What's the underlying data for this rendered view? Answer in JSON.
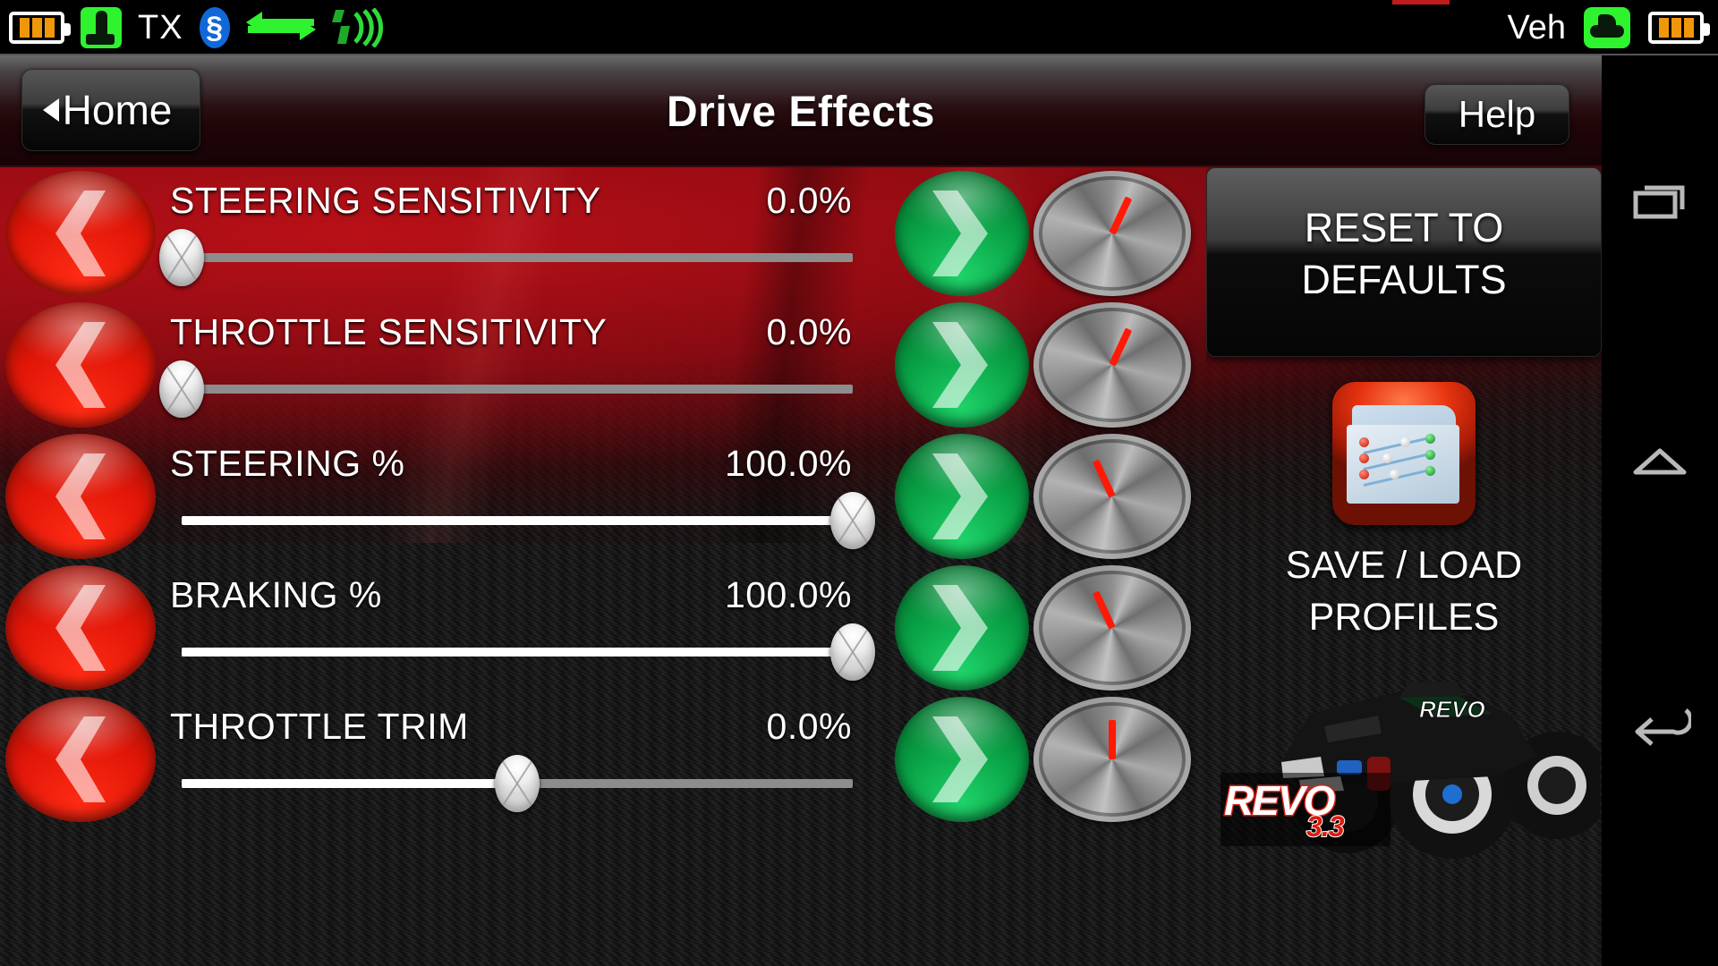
{
  "statusbar": {
    "battery_left_icon": "battery-icon",
    "tx_icon": "transmitter-icon",
    "tx_label": "TX",
    "bluetooth_icon": "bluetooth-icon",
    "link_icon": "two-way-link-icon",
    "signal_icon": "signal-strength-icon",
    "vehicle_label": "Veh",
    "vehicle_icon": "vehicle-icon",
    "battery_right_icon": "battery-icon",
    "accent_orange": "#f0960a",
    "accent_green": "#2ff32f",
    "accent_blue": "#1168d8",
    "accent_red": "#c21b1b"
  },
  "titlebar": {
    "home_label": "Home",
    "title": "Drive Effects",
    "help_label": "Help"
  },
  "rows": [
    {
      "label": "STEERING SENSITIVITY",
      "value": "0.0%",
      "fill_pct": 0,
      "thumb_pct": 0,
      "dial_deg": 205,
      "highlight": true
    },
    {
      "label": "THROTTLE SENSITIVITY",
      "value": "0.0%",
      "fill_pct": 0,
      "thumb_pct": 0,
      "dial_deg": 205,
      "highlight": true
    },
    {
      "label": "STEERING %",
      "value": "100.0%",
      "fill_pct": 100,
      "thumb_pct": 100,
      "dial_deg": 155,
      "highlight": false
    },
    {
      "label": "BRAKING %",
      "value": "100.0%",
      "fill_pct": 100,
      "thumb_pct": 100,
      "dial_deg": 155,
      "highlight": false
    },
    {
      "label": "THROTTLE TRIM",
      "value": "0.0%",
      "fill_pct": 50,
      "thumb_pct": 50,
      "dial_deg": 180,
      "highlight": false
    }
  ],
  "row_controls": {
    "decrement_icon": "chevron-left-icon",
    "increment_icon": "chevron-right-icon",
    "dial_icon": "rotary-dial-icon"
  },
  "rightpanel": {
    "reset_label": "RESET TO\nDEFAULTS",
    "reset_line1": "RESET TO",
    "reset_line2": "DEFAULTS",
    "profiles_icon": "profiles-folder-icon",
    "profiles_line1": "SAVE / LOAD",
    "profiles_line2": "PROFILES",
    "vehicle_photo": "revo-truck-photo",
    "vehicle_logo_main": "REVO",
    "vehicle_logo_sub": "3.3"
  },
  "navbar": {
    "recents_icon": "recents-icon",
    "home_icon": "home-icon",
    "back_icon": "back-icon"
  }
}
